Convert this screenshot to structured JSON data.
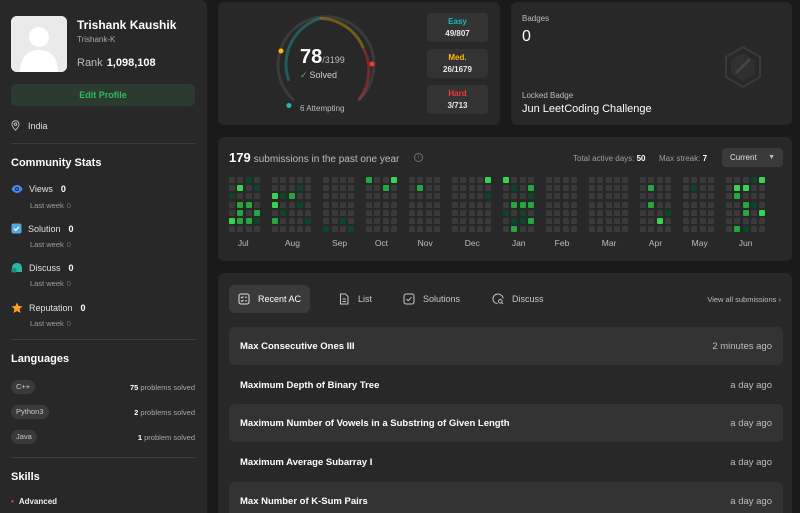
{
  "profile": {
    "name": "Trishank Kaushik",
    "handle": "Trishank-K",
    "rank_label": "Rank",
    "rank_value": "1,098,108",
    "edit_label": "Edit Profile",
    "location": "India"
  },
  "community": {
    "title": "Community Stats",
    "items": [
      {
        "label": "Views",
        "value": "0",
        "sub_label": "Last week",
        "sub_value": "0",
        "icon": "eye-icon",
        "color": "#3e8bf7"
      },
      {
        "label": "Solution",
        "value": "0",
        "sub_label": "Last week",
        "sub_value": "0",
        "icon": "solution-icon",
        "color": "#50a8e4"
      },
      {
        "label": "Discuss",
        "value": "0",
        "sub_label": "Last week",
        "sub_value": "0",
        "icon": "discuss-icon",
        "color": "#2cb8a6"
      },
      {
        "label": "Reputation",
        "value": "0",
        "sub_label": "Last week",
        "sub_value": "0",
        "icon": "star-icon",
        "color": "#ffa116"
      }
    ]
  },
  "languages": {
    "title": "Languages",
    "items": [
      {
        "name": "C++",
        "count": "75",
        "suffix": "problems solved"
      },
      {
        "name": "Python3",
        "count": "2",
        "suffix": "problems solved"
      },
      {
        "name": "Java",
        "count": "1",
        "suffix": "problem solved"
      }
    ]
  },
  "skills": {
    "title": "Skills",
    "level": "Advanced"
  },
  "solved": {
    "count": "78",
    "total": "/3199",
    "label": "Solved",
    "attempting": "6 Attempting",
    "difficulties": [
      {
        "label": "Easy",
        "value": "49/807",
        "color": "#1cbaba"
      },
      {
        "label": "Med.",
        "value": "26/1679",
        "color": "#ffb700"
      },
      {
        "label": "Hard",
        "value": "3/713",
        "color": "#f63737"
      }
    ]
  },
  "badges": {
    "label": "Badges",
    "count": "0",
    "locked_label": "Locked Badge",
    "locked_name": "Jun LeetCoding Challenge"
  },
  "submissions": {
    "count": "179",
    "text": "submissions in the past one year",
    "active_label": "Total active days:",
    "active_value": "50",
    "streak_label": "Max streak:",
    "streak_value": "7",
    "period": "Current",
    "months": [
      "Jul",
      "Aug",
      "Sep",
      "Oct",
      "Nov",
      "Dec",
      "Jan",
      "Feb",
      "Mar",
      "Apr",
      "May",
      "Jun"
    ]
  },
  "recent": {
    "tabs": [
      {
        "label": "Recent AC",
        "icon": "recent-ac-icon"
      },
      {
        "label": "List",
        "icon": "list-icon"
      },
      {
        "label": "Solutions",
        "icon": "solutions-icon"
      },
      {
        "label": "Discuss",
        "icon": "discuss-icon"
      }
    ],
    "view_all": "View all submissions",
    "items": [
      {
        "title": "Max Consecutive Ones III",
        "when": "2 minutes ago"
      },
      {
        "title": "Maximum Depth of Binary Tree",
        "when": "a day ago"
      },
      {
        "title": "Maximum Number of Vowels in a Substring of Given Length",
        "when": "a day ago"
      },
      {
        "title": "Maximum Average Subarray I",
        "when": "a day ago"
      },
      {
        "title": "Max Number of K-Sum Pairs",
        "when": "a day ago"
      }
    ]
  }
}
